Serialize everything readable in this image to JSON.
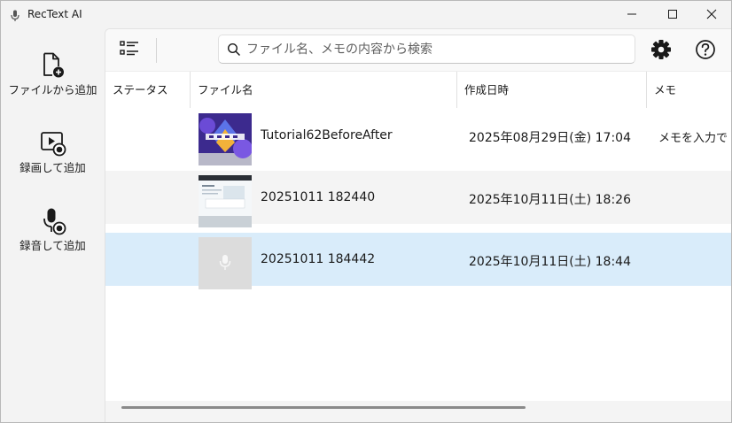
{
  "window": {
    "title": "RecText AI",
    "icon": "microphone-icon"
  },
  "nav": {
    "items": [
      {
        "label": "ファイルから追加",
        "icon": "file-add-icon"
      },
      {
        "label": "録画して追加",
        "icon": "video-record-icon"
      },
      {
        "label": "録音して追加",
        "icon": "mic-record-icon"
      }
    ]
  },
  "toolbar": {
    "list_icon": "list-view-icon",
    "search_placeholder": "ファイル名、メモの内容から検索",
    "search_value": "",
    "settings_icon": "gear-icon",
    "help_icon": "help-icon"
  },
  "table": {
    "columns": [
      "ステータス",
      "ファイル名",
      "作成日時",
      "メモ"
    ],
    "rows": [
      {
        "status": "",
        "name": "Tutorial62BeforeAfter",
        "created": "2025年08月29日(金) 17:04",
        "memo": "メモを入力で",
        "thumb": "video-thumbnail-colorful",
        "selected": false
      },
      {
        "status": "",
        "name": "20251011 182440",
        "created": "2025年10月11日(土) 18:26",
        "memo": "",
        "thumb": "screen-recording-thumbnail",
        "selected": false
      },
      {
        "status": "",
        "name": "20251011 184442",
        "created": "2025年10月11日(土) 18:44",
        "memo": "",
        "thumb": "audio-placeholder-thumbnail",
        "selected": true
      }
    ]
  },
  "colors": {
    "selected_row": "#d9ecfa",
    "alt_row": "#f4f4f4",
    "chrome_bg": "#f3f3f3"
  }
}
